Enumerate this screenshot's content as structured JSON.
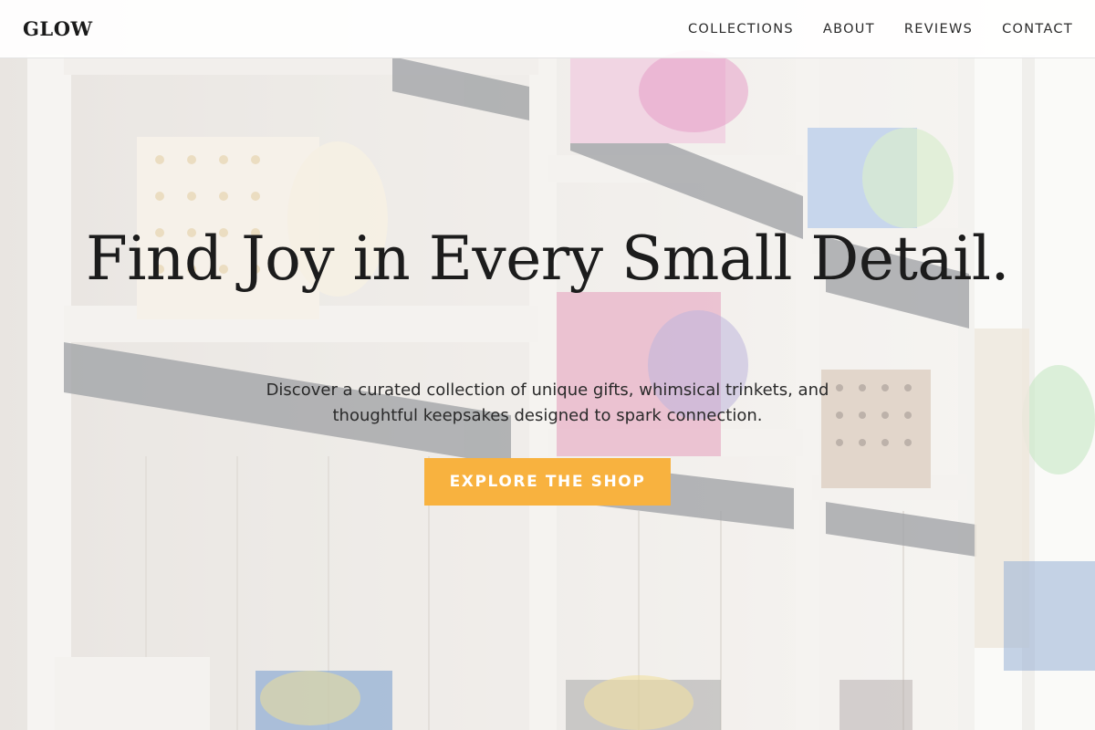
{
  "brand": {
    "logo": "GLOW"
  },
  "nav": {
    "items": [
      {
        "label": "COLLECTIONS"
      },
      {
        "label": "ABOUT"
      },
      {
        "label": "REVIEWS"
      },
      {
        "label": "CONTACT"
      }
    ]
  },
  "hero": {
    "title": "Find Joy in Every Small Detail.",
    "subtitle": "Discover a curated collection of unique gifts, whimsical trinkets, and thoughtful keepsakes designed to spark connection.",
    "cta_label": "EXPLORE THE SHOP"
  },
  "colors": {
    "accent": "#f8b23f",
    "text": "#1c1c1c",
    "header_bg": "#ffffff"
  }
}
